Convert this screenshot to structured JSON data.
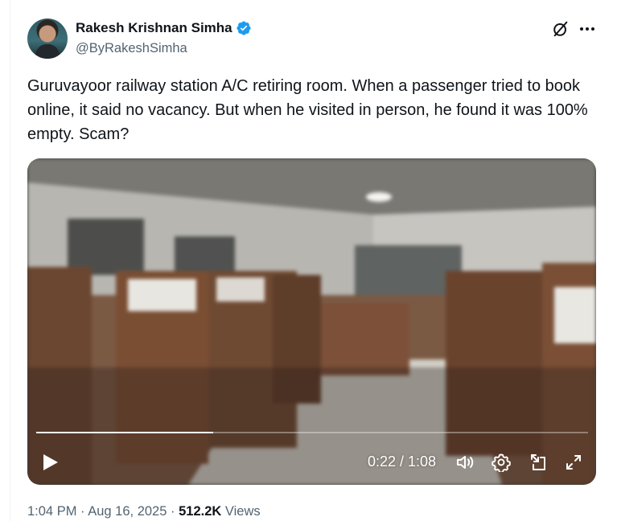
{
  "author": {
    "name": "Rakesh Krishnan Simha",
    "handle": "@ByRakeshSimha",
    "verified": true
  },
  "icons": {
    "verified": "verified-badge-icon",
    "grok": "grok-icon",
    "more": "more-options-icon",
    "play": "play-icon",
    "volume": "volume-icon",
    "settings": "settings-gear-icon",
    "pip": "picture-in-picture-icon",
    "fullscreen": "fullscreen-icon"
  },
  "tweet": {
    "text": "Guruvayoor railway station A/C retiring room. When a passenger tried to book online, it said no vacancy. But when he visited in person, he found it was 100% empty. Scam?"
  },
  "video": {
    "current_time": "0:22",
    "duration": "1:08",
    "time_display": "0:22 / 1:08",
    "progress_fraction": 0.32
  },
  "meta": {
    "time": "1:04 PM",
    "separator": "·",
    "date": "Aug 16, 2025",
    "views_count": "512.2K",
    "views_label": "Views"
  },
  "colors": {
    "accent_blue": "#1d9bf0",
    "text_primary": "#0f1419",
    "text_secondary": "#536471"
  }
}
